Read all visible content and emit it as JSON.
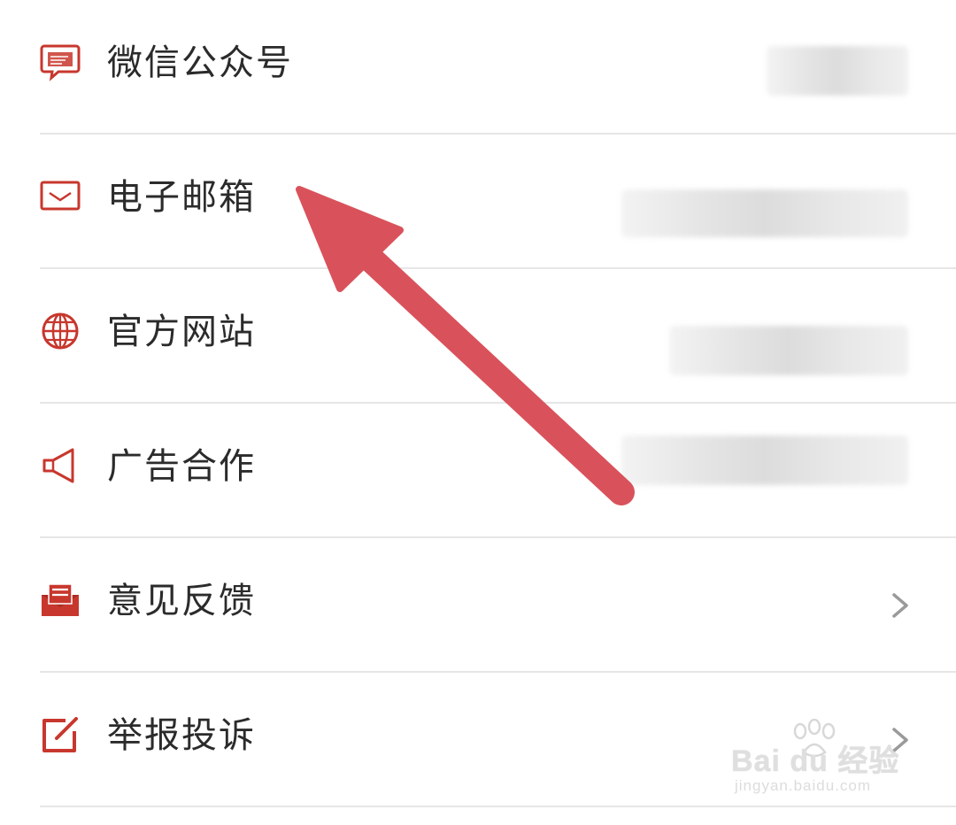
{
  "menu": {
    "items": [
      {
        "label": "微信公众号",
        "icon": "wechat-chat-icon",
        "value_visible": false,
        "chevron": false
      },
      {
        "label": "电子邮箱",
        "icon": "mail-envelope-icon",
        "value_visible": false,
        "chevron": false
      },
      {
        "label": "官方网站",
        "icon": "globe-icon",
        "value_visible": false,
        "chevron": false
      },
      {
        "label": "广告合作",
        "icon": "megaphone-icon",
        "value_visible": false,
        "chevron": false
      },
      {
        "label": "意见反馈",
        "icon": "feedback-mail-icon",
        "value_visible": false,
        "chevron": true
      },
      {
        "label": "举报投诉",
        "icon": "edit-square-icon",
        "value_visible": false,
        "chevron": true
      }
    ]
  },
  "colors": {
    "accent": "#c8372d",
    "text": "#2b2b2b",
    "divider": "#e6e6e6",
    "chevron": "#9a9a9a",
    "arrow": "#d9525b"
  },
  "watermark": {
    "brand": "Bai du 经验",
    "url": "jingyan.baidu.com"
  }
}
